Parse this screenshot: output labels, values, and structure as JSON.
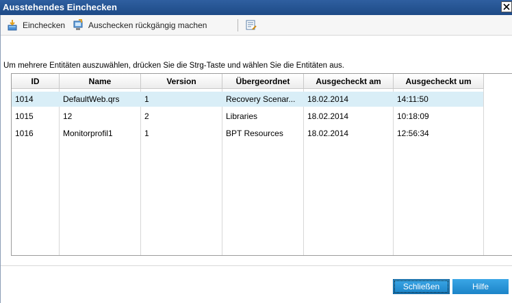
{
  "window": {
    "title": "Ausstehendes Einchecken"
  },
  "toolbar": {
    "checkin_label": "Einchecken",
    "undo_checkout_label": "Auschecken rückgängig machen"
  },
  "hint": "Um mehrere Entitäten auszuwählen, drücken Sie die Strg-Taste und wählen Sie die Entitäten aus.",
  "table": {
    "columns": [
      "ID",
      "Name",
      "Version",
      "Übergeordnet",
      "Ausgecheckt am",
      "Ausgecheckt um"
    ],
    "rows": [
      [
        "1014",
        "DefaultWeb.qrs",
        "1",
        "Recovery Scenar...",
        "18.02.2014",
        "14:11:50"
      ],
      [
        "1015",
        "12",
        "2",
        "Libraries",
        "18.02.2014",
        "10:18:09"
      ],
      [
        "1016",
        "Monitorprofil1",
        "1",
        "BPT Resources",
        "18.02.2014",
        "12:56:34"
      ]
    ],
    "selected_row": 0
  },
  "buttons": {
    "close_label": "Schließen",
    "help_label": "Hilfe"
  },
  "colors": {
    "title_bar": "#1d4a86",
    "button": "#1c84c8",
    "selection": "#d9eef7"
  }
}
